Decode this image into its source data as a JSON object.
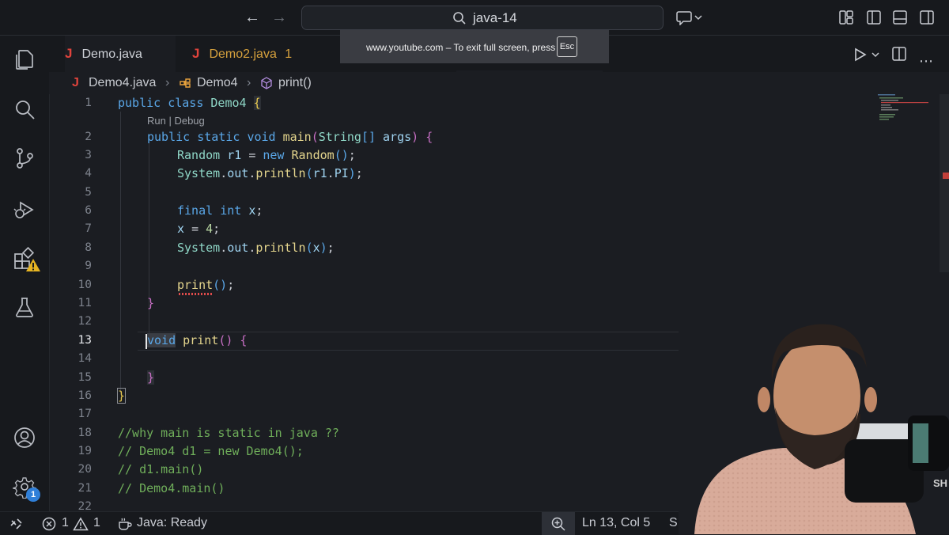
{
  "titlebar": {
    "search_text": "java-14",
    "back_icon": "arrow-left-icon",
    "forward_icon": "arrow-right-icon"
  },
  "fullscreen_banner": {
    "message": "www.youtube.com – To exit full screen, press",
    "key": "Esc"
  },
  "tabs": [
    {
      "icon": "J",
      "label": "Demo.java",
      "badge": ""
    },
    {
      "icon": "J",
      "label": "Demo2.java",
      "badge": "1"
    }
  ],
  "breadcrumb": {
    "file_icon": "J",
    "file": "Demo4.java",
    "class": "Demo4",
    "method": "print()"
  },
  "codelens": "Run | Debug",
  "code": {
    "line_numbers": [
      "1",
      "2",
      "3",
      "4",
      "5",
      "6",
      "7",
      "8",
      "9",
      "10",
      "11",
      "12",
      "13",
      "14",
      "15",
      "16",
      "17",
      "18",
      "19",
      "20",
      "21",
      "22"
    ],
    "comment_18": "//why main is static in java ??",
    "comment_19": "// Demo4 d1 = new Demo4();",
    "comment_20": "// d1.main()",
    "comment_21": "// Demo4.main()"
  },
  "activity_badges": {
    "settings_count": "1"
  },
  "statusbar": {
    "errors": "1",
    "warnings": "1",
    "java_status": "Java: Ready",
    "cursor": "Ln 13, Col 5",
    "truncated": "S"
  },
  "colors": {
    "keyword": "#5aa7e8",
    "class": "#8fd7c7",
    "function": "#e4d58d",
    "comment": "#6fae5a",
    "error": "#e0433c",
    "accent": "#2f7fd8"
  }
}
